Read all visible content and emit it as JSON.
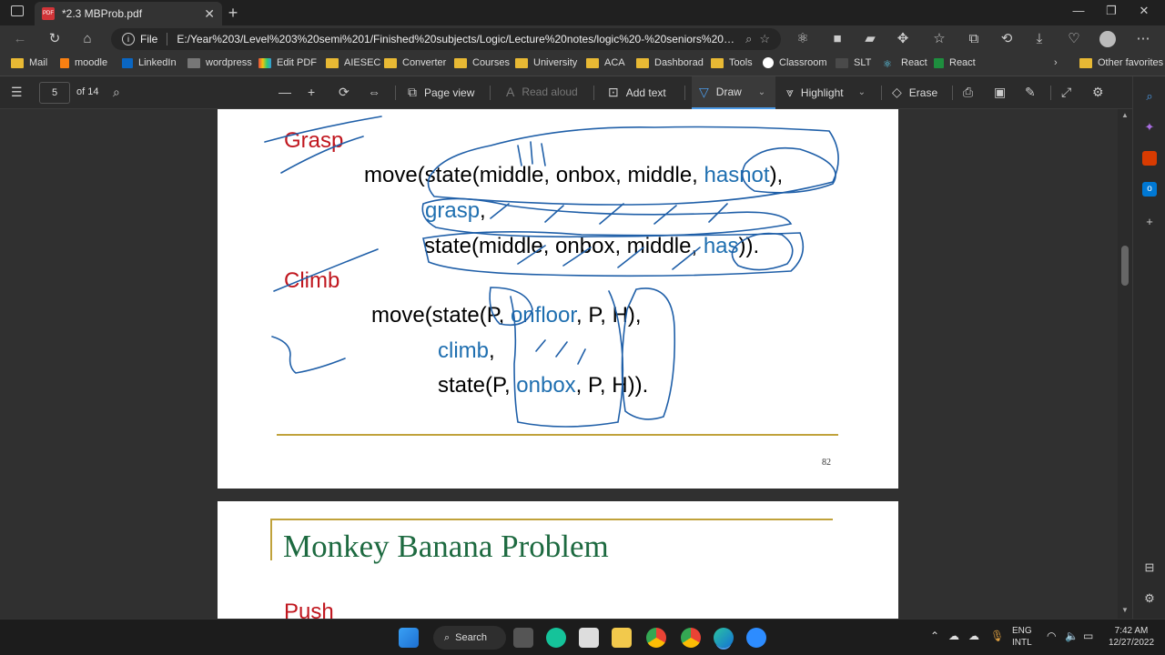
{
  "window": {
    "tab_title": "*2.3 MBProb.pdf",
    "url_label": "File",
    "url": "E:/Year%203/Level%203%20semi%201/Finished%20subjects/Logic/Lecture%20notes/logic%20-%20seniors%20note..."
  },
  "bookmarks": [
    {
      "label": "Mail"
    },
    {
      "label": "moodle"
    },
    {
      "label": "LinkedIn"
    },
    {
      "label": "wordpress"
    },
    {
      "label": "Edit PDF"
    },
    {
      "label": "AIESEC"
    },
    {
      "label": "Converter"
    },
    {
      "label": "Courses"
    },
    {
      "label": "University"
    },
    {
      "label": "ACA"
    },
    {
      "label": "Dashborad"
    },
    {
      "label": "Tools"
    },
    {
      "label": "Classroom"
    },
    {
      "label": "SLT"
    },
    {
      "label": "React"
    },
    {
      "label": "React"
    },
    {
      "label": "Other favorites"
    }
  ],
  "pdf_toolbar": {
    "page_current": "5",
    "page_total": "of 14",
    "page_view": "Page view",
    "read_aloud": "Read aloud",
    "add_text": "Add text",
    "draw": "Draw",
    "highlight": "Highlight",
    "erase": "Erase"
  },
  "slide1": {
    "heading_grasp": "Grasp",
    "grasp_line1_a": "move(state(middle, onbox, middle, ",
    "grasp_line1_b": "hasnot",
    "grasp_line1_c": "),",
    "grasp_line2": "grasp",
    "grasp_line2_c": ",",
    "grasp_line3_a": "state(middle, onbox, middle, ",
    "grasp_line3_b": "has",
    "grasp_line3_c": ")).",
    "heading_climb": "Climb",
    "climb_line1_a": "move(state(P, ",
    "climb_line1_b": "onfloor",
    "climb_line1_c": ", P, H),",
    "climb_line2": "climb",
    "climb_line2_c": ",",
    "climb_line3_a": "state(P, ",
    "climb_line3_b": "onbox",
    "climb_line3_c": ", P, H)).",
    "page_number": "82"
  },
  "slide2": {
    "title": "Monkey Banana Problem",
    "heading_push": "Push"
  },
  "taskbar": {
    "search": "Search",
    "lang_top": "ENG",
    "lang_bottom": "INTL",
    "time": "7:42 AM",
    "date": "12/27/2022"
  }
}
